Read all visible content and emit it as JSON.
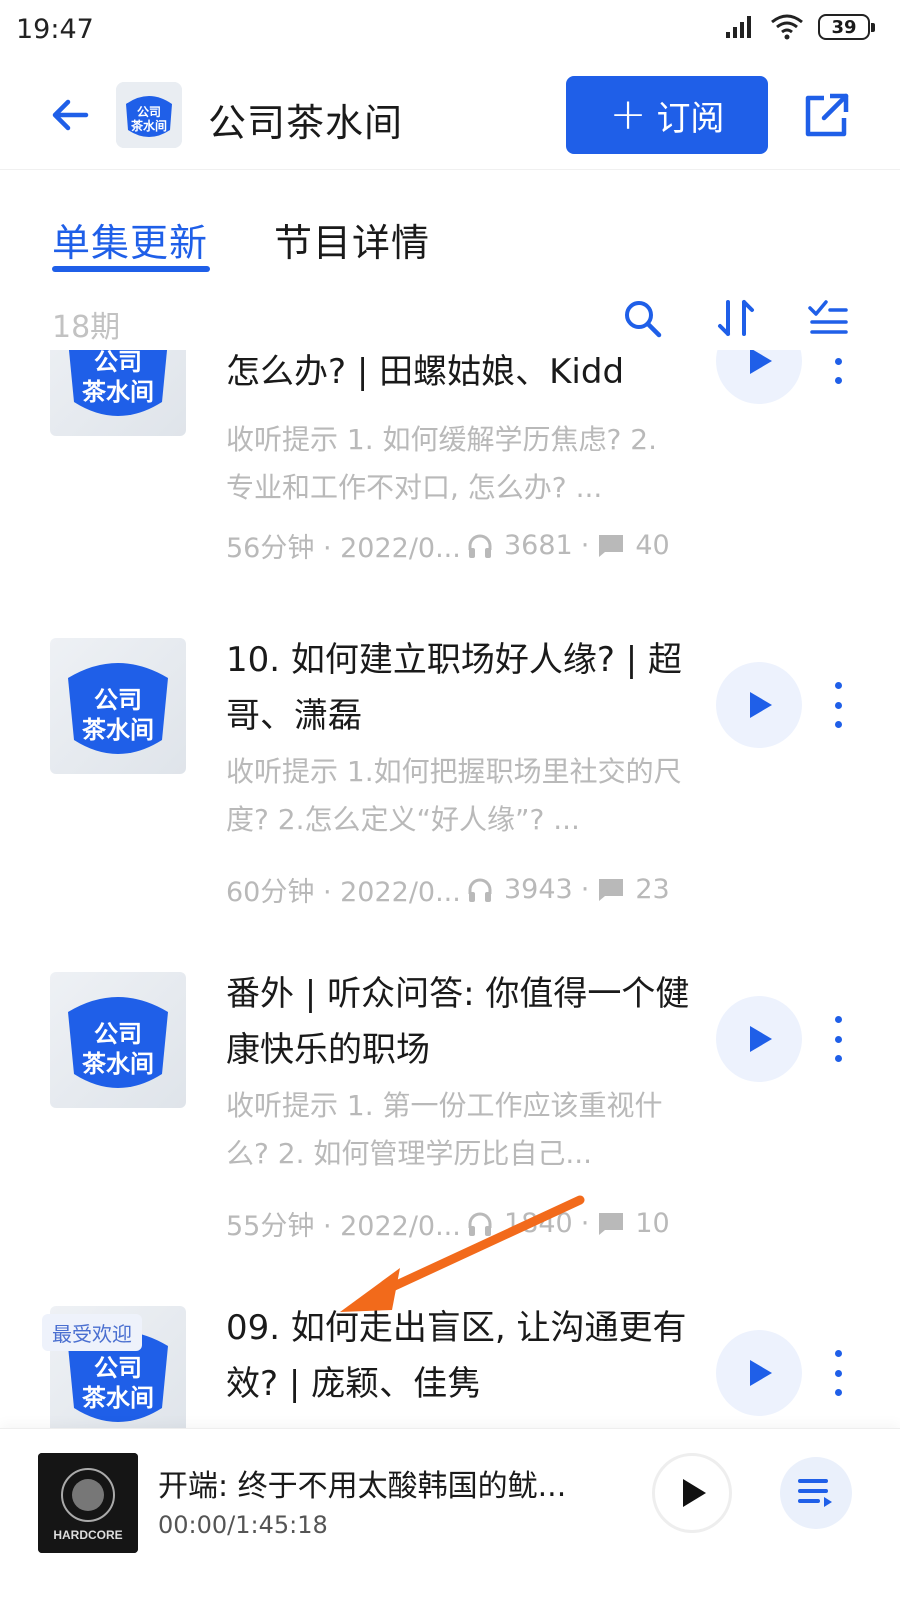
{
  "status_bar": {
    "time": "19:47",
    "battery": "39",
    "icons": [
      "signal-icon",
      "wifi-icon",
      "battery-icon"
    ]
  },
  "header": {
    "back_icon": "arrow-left-icon",
    "title": "公司茶水间",
    "subscribe_label": "订阅",
    "subscribe_icon": "plus-icon",
    "share_icon": "share-icon",
    "logo_text_line1": "公司",
    "logo_text_line2": "茶水间"
  },
  "tabs": [
    {
      "label": "单集更新",
      "active": true
    },
    {
      "label": "节目详情",
      "active": false
    }
  ],
  "list_toolbar": {
    "count": "18期",
    "icons": [
      "search-icon",
      "sort-icon",
      "filter-list-icon"
    ]
  },
  "cover_text": {
    "line1": "公司",
    "line2": "茶水间"
  },
  "episodes": [
    {
      "title": "怎么办? | 田螺姑娘、Kidd",
      "desc": "收听提示 1. 如何缓解学历焦虑? 2. 专业和工作不对口, 怎么办? ...",
      "duration": "56分钟 · 2022/0...",
      "plays": "3681",
      "comments": "40"
    },
    {
      "title": "10. 如何建立职场好人缘? | 超哥、潇磊",
      "desc": "收听提示 1.如何把握职场里社交的尺度? 2.怎么定义“好人缘”? ...",
      "duration": "60分钟 · 2022/0...",
      "plays": "3943",
      "comments": "23"
    },
    {
      "title": "番外 | 听众问答: 你值得一个健康快乐的职场",
      "desc": "收听提示 1. 第一份工作应该重视什么? 2. 如何管理学历比自己...",
      "duration": "55分钟 · 2022/0...",
      "plays": "1840",
      "comments": "10"
    },
    {
      "title": "09. 如何走出盲区, 让沟通更有效? | 庞颖、佳隽",
      "badge": "最受欢迎"
    }
  ],
  "mini_player": {
    "title": "开端: 终于不用太酸韩国的鱿...",
    "time": "00:00/1:45:18",
    "cover_text": "HARDCORE"
  },
  "colors": {
    "accent": "#1f5fe8",
    "muted_text": "#b9b9b9",
    "annotation_arrow": "#f26a1b"
  }
}
